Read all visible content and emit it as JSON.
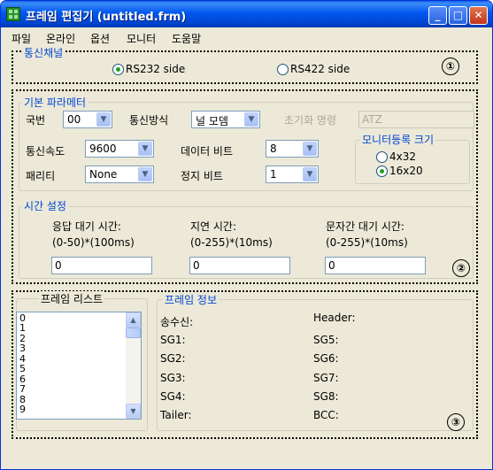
{
  "window": {
    "title": "프레임 편집기 (untitled.frm)"
  },
  "menu": [
    "파일",
    "온라인",
    "옵션",
    "모니터",
    "도움말"
  ],
  "channel": {
    "legend": "통신채널",
    "options": [
      "RS232 side",
      "RS422 side"
    ],
    "selected": "RS232 side",
    "marker": "①"
  },
  "params": {
    "legend": "기본 파라메터",
    "station": {
      "label": "국번",
      "value": "00"
    },
    "comm_mode": {
      "label": "통신방식",
      "value": "널 모뎀"
    },
    "init_cmd": {
      "label": "초기화 명령",
      "value": "ATZ"
    },
    "speed": {
      "label": "통신속도",
      "value": "9600"
    },
    "data_bits": {
      "label": "데이터 비트",
      "value": "8"
    },
    "parity": {
      "label": "패리티",
      "value": "None"
    },
    "stop_bits": {
      "label": "정지 비트",
      "value": "1"
    },
    "monitor_size": {
      "legend": "모니터등록 크기",
      "options": [
        "4x32",
        "16x20"
      ],
      "selected": "16x20"
    }
  },
  "timing": {
    "legend": "시간 설정",
    "response_wait": {
      "label": "응답 대기 시간:",
      "range": "(0-50)*(100ms)",
      "value": "0"
    },
    "delay": {
      "label": "지연 시간:",
      "range": "(0-255)*(10ms)",
      "value": "0"
    },
    "char_wait": {
      "label": "문자간 대기 시간:",
      "range": "(0-255)*(10ms)",
      "value": "0"
    },
    "marker": "②"
  },
  "frames": {
    "list_title": "프레임 리스트",
    "items": [
      "0",
      "1",
      "2",
      "3",
      "4",
      "5",
      "6",
      "7",
      "8",
      "9"
    ],
    "info_legend": "프레임 정보",
    "fields": {
      "send_recv": "송수신:",
      "header": "Header:",
      "sg1": "SG1:",
      "sg5": "SG5:",
      "sg2": "SG2:",
      "sg6": "SG6:",
      "sg3": "SG3:",
      "sg7": "SG7:",
      "sg4": "SG4:",
      "sg8": "SG8:",
      "tailer": "Tailer:",
      "bcc": "BCC:"
    },
    "marker": "③"
  },
  "colors": {
    "titlebar": "#0055E5",
    "legend_text": "#0046D5",
    "window_bg": "#ECE9D8",
    "radio_dot": "#21A121"
  }
}
